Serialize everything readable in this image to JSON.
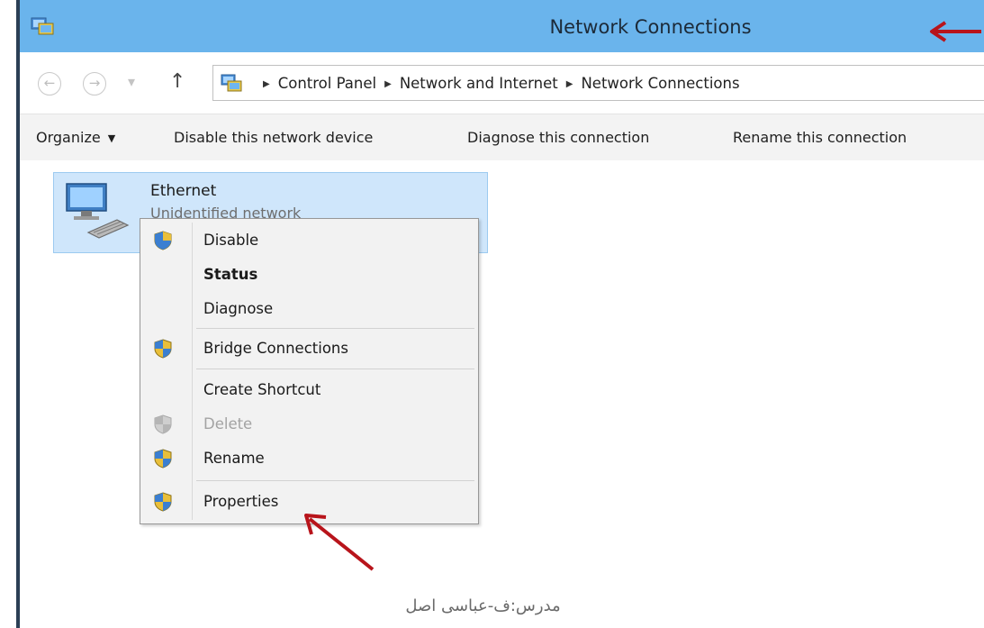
{
  "window": {
    "title": "Network Connections",
    "title_icon": "network-connections-icon",
    "accent_color": "#6ab4ec"
  },
  "navigation": {
    "back_icon": "back-arrow-icon",
    "forward_icon": "forward-arrow-icon",
    "recent_icon": "chevron-down-icon",
    "up_icon": "up-arrow-icon",
    "breadcrumb": [
      "Control Panel",
      "Network and Internet",
      "Network Connections"
    ]
  },
  "commandbar": {
    "organize": "Organize",
    "disable_device": "Disable this network device",
    "diagnose_connection": "Diagnose this connection",
    "rename_connection": "Rename this connection"
  },
  "connection": {
    "name": "Ethernet",
    "status": "Unidentified network",
    "icon": "ethernet-adapter-icon"
  },
  "context_menu": {
    "items": [
      {
        "label": "Disable",
        "icon": "uac-shield-icon",
        "bold": false,
        "disabled": false
      },
      {
        "label": "Status",
        "icon": "",
        "bold": true,
        "disabled": false
      },
      {
        "label": "Diagnose",
        "icon": "",
        "bold": false,
        "disabled": false
      },
      {
        "label": "Bridge Connections",
        "icon": "uac-shield-icon",
        "bold": false,
        "disabled": false
      },
      {
        "label": "Create Shortcut",
        "icon": "",
        "bold": false,
        "disabled": false
      },
      {
        "label": "Delete",
        "icon": "uac-shield-icon",
        "bold": false,
        "disabled": true
      },
      {
        "label": "Rename",
        "icon": "uac-shield-icon",
        "bold": false,
        "disabled": false
      },
      {
        "label": "Properties",
        "icon": "uac-shield-icon",
        "bold": false,
        "disabled": false
      }
    ]
  },
  "annotations": {
    "arrow_color": "#b8141b",
    "watermark": "مدرس:ف-عباسی اصل"
  }
}
